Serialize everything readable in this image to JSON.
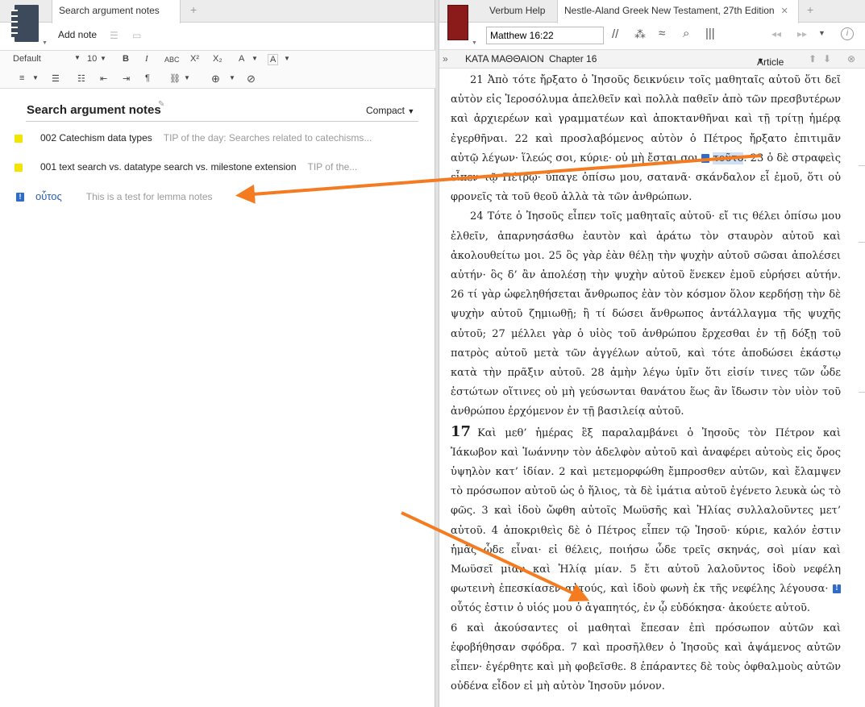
{
  "left": {
    "tab_label": "Search argument notes",
    "add_note_label": "Add note",
    "font_name": "Default",
    "font_size": "10",
    "title": "Search argument notes",
    "view_mode": "Compact",
    "notes": [
      {
        "title": "002 Catechism data types",
        "tip": "TIP of the day: Searches related to catechisms..."
      },
      {
        "title": "001 text search vs. datatype search vs. milestone extension",
        "tip": "TIP of the..."
      },
      {
        "title": "οὗτος",
        "tip": "This  is a test for lemma notes"
      }
    ]
  },
  "right": {
    "tabs": [
      "Verbum Help",
      "Nestle-Aland Greek New Testament, 27th Edition"
    ],
    "reference": "Matthew 16:22",
    "breadcrumb_book": "ΚΑΤΑ ΜΑΘΘΑΙΟΝ",
    "breadcrumb_chapter": "Chapter 16",
    "article_label": "Article",
    "para1": "21 Ἀπὸ τότε ἤρξατο ὁ Ἰησοῦς δεικνύειν τοῖς μαθηταῖς αὐτοῦ ὅτι δεῖ αὐτὸν εἰς Ἱεροσόλυμα ἀπελθεῖν καὶ πολλὰ παθεῖν ἀπὸ τῶν πρεσβυτέρων καὶ ἀρχιερέων καὶ γραμματέων καὶ ἀποκτανθῆναι καὶ τῇ τρίτῃ ἡμέρᾳ ἐγερθῆναι. 22 καὶ προσλαβόμενος αὐτὸν ὁ Πέτρος ἤρξατο ἐπιτιμᾶν αὐτῷ λέγων· ἵλεώς σοι, κύριε· οὐ μὴ ἔσται σοι",
    "highlight_word": "τοῦτο",
    "para1_end": ". 23 ὁ δὲ στραφεὶς εἶπεν τῷ Πέτρῳ· ὕπαγε ὀπίσω μου, σατανᾶ· σκάνδαλον εἶ ἐμοῦ, ὅτι οὐ φρονεῖς τὰ τοῦ θεοῦ ἀλλὰ τὰ τῶν ἀνθρώπων.",
    "para2": "24 Τότε ὁ Ἰησοῦς εἶπεν τοῖς μαθηταῖς αὐτοῦ· εἴ τις θέλει ὀπίσω μου ἐλθεῖν, ἀπαρνησάσθω ἑαυτὸν καὶ ἀράτω τὸν σταυρὸν αὐτοῦ καὶ ἀκολουθείτω μοι. 25 ὃς γὰρ ἐὰν θέλῃ τὴν ψυχὴν αὐτοῦ σῶσαι ἀπολέσει αὐτήν· ὃς δ’ ἂν ἀπολέσῃ τὴν ψυχὴν αὐτοῦ ἕνεκεν ἐμοῦ εὑρήσει αὐτήν. 26 τί γὰρ ὠφεληθήσεται ἄνθρωπος ἐὰν τὸν κόσμον ὅλον κερδήσῃ τὴν δὲ ψυχὴν αὐτοῦ ζημιωθῇ; ἢ τί δώσει ἄνθρωπος ἀντάλλαγμα τῆς ψυχῆς αὐτοῦ; 27 μέλλει γὰρ ὁ υἱὸς τοῦ ἀνθρώπου ἔρχεσθαι ἐν τῇ δόξῃ τοῦ πατρὸς αὐτοῦ μετὰ τῶν ἀγγέλων αὐτοῦ, καὶ τότε ἀποδώσει ἑκάστῳ κατὰ τὴν πρᾶξιν αὐτοῦ. 28 ἀμὴν λέγω ὑμῖν ὅτι εἰσίν τινες τῶν ὧδε ἑστώτων οἵτινες οὐ μὴ γεύσωνται θανάτου ἕως ἂν ἴδωσιν τὸν υἱὸν τοῦ ἀνθρώπου ἐρχόμενον ἐν τῇ βασιλείᾳ αὐτοῦ.",
    "chapter17": "17",
    "para3": "Καὶ μεθ’ ἡμέρας ἓξ παραλαμβάνει ὁ Ἰησοῦς τὸν Πέτρον καὶ Ἰάκωβον καὶ Ἰωάννην τὸν ἀδελφὸν αὐτοῦ καὶ ἀναφέρει αὐτοὺς εἰς ὄρος ὑψηλὸν κατ’ ἰδίαν. 2 καὶ μετεμορφώθη ἔμπροσθεν αὐτῶν, καὶ ἔλαμψεν τὸ πρόσωπον αὐτοῦ ὡς ὁ ἥλιος, τὰ δὲ ἱμάτια αὐτοῦ ἐγένετο λευκὰ ὡς τὸ φῶς. 3 καὶ ἰδοὺ ὤφθη αὐτοῖς Μωϋσῆς καὶ Ἠλίας συλλαλοῦντες μετ’ αὐτοῦ. 4 ἀποκριθεὶς δὲ ὁ Πέτρος εἶπεν τῷ Ἰησοῦ· κύριε, καλόν ἐστιν ἡμᾶς ὧδε εἶναι· εἰ θέλεις, ποιήσω ὧδε τρεῖς σκηνάς, σοὶ μίαν καὶ Μωϋσεῖ μίαν καὶ Ἠλίᾳ μίαν. 5 ἔτι αὐτοῦ λαλοῦντος ἰδοὺ νεφέλη φωτεινὴ ἐπεσκίασεν αὐτούς, καὶ ἰδοὺ φωνὴ ἐκ τῆς νεφέλης λέγουσα·",
    "para3_end": "οὗτός ἐστιν ὁ υἱός μου ὁ ἀγαπητός, ἐν ᾧ εὐδόκησα· ἀκούετε αὐτοῦ.",
    "para4": "6 καὶ ἀκούσαντες οἱ μαθηταὶ ἔπεσαν ἐπὶ πρόσωπον αὐτῶν καὶ ἐφοβήθησαν σφόδρα. 7 καὶ προσῆλθεν ὁ Ἰησοῦς καὶ ἁψάμενος αὐτῶν εἶπεν· ἐγέρθητε καὶ μὴ φοβεῖσθε. 8 ἐπάραντες δὲ τοὺς ὀφθαλμοὺς αὐτῶν οὐδένα εἶδον εἰ μὴ αὐτὸν Ἰησοῦν μόνον."
  },
  "colors": {
    "arrow": "#f47b20",
    "note_flag": "#2f6cc8",
    "sticky": "#f2e600",
    "bible_cover": "#8b1a1a"
  }
}
